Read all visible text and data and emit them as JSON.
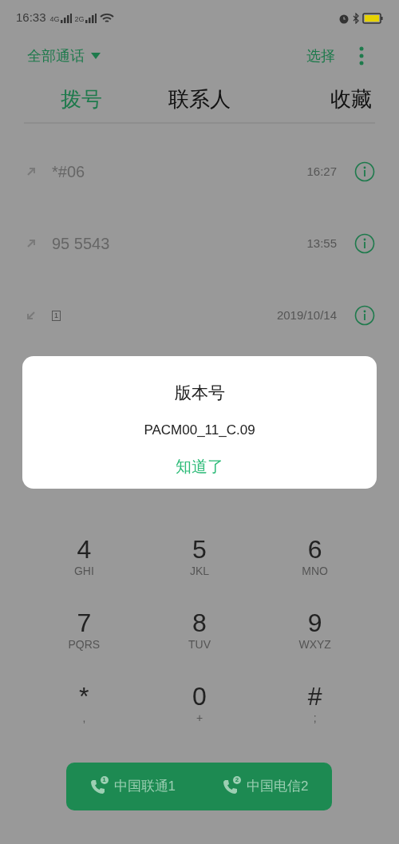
{
  "status_bar": {
    "time": "16:33",
    "networks": [
      "4G",
      "2G"
    ]
  },
  "header": {
    "filter": "全部通话",
    "select": "选择"
  },
  "tabs": [
    {
      "label": "拨号",
      "selected": true
    },
    {
      "label": "联系人",
      "selected": false
    },
    {
      "label": "收藏",
      "selected": false
    }
  ],
  "calls": [
    {
      "kind": "outgoing",
      "number": "*#06",
      "time": "16:27"
    },
    {
      "kind": "outgoing",
      "number": "95 5543",
      "time": "13:55"
    },
    {
      "kind": "incoming",
      "sim": "1",
      "time": "2019/10/14"
    }
  ],
  "keypad": [
    {
      "digit": "4",
      "letters": "GHI"
    },
    {
      "digit": "5",
      "letters": "JKL"
    },
    {
      "digit": "6",
      "letters": "MNO"
    },
    {
      "digit": "7",
      "letters": "PQRS"
    },
    {
      "digit": "8",
      "letters": "TUV"
    },
    {
      "digit": "9",
      "letters": "WXYZ"
    },
    {
      "digit": "*",
      "letters": ","
    },
    {
      "digit": "0",
      "letters": "+"
    },
    {
      "digit": "#",
      "letters": ";"
    }
  ],
  "carriers": [
    {
      "sim": "1",
      "label": "中国联通1"
    },
    {
      "sim": "2",
      "label": "中国电信2"
    }
  ],
  "dialog": {
    "title": "版本号",
    "message": "PACM00_11_C.09",
    "button": "知道了"
  }
}
